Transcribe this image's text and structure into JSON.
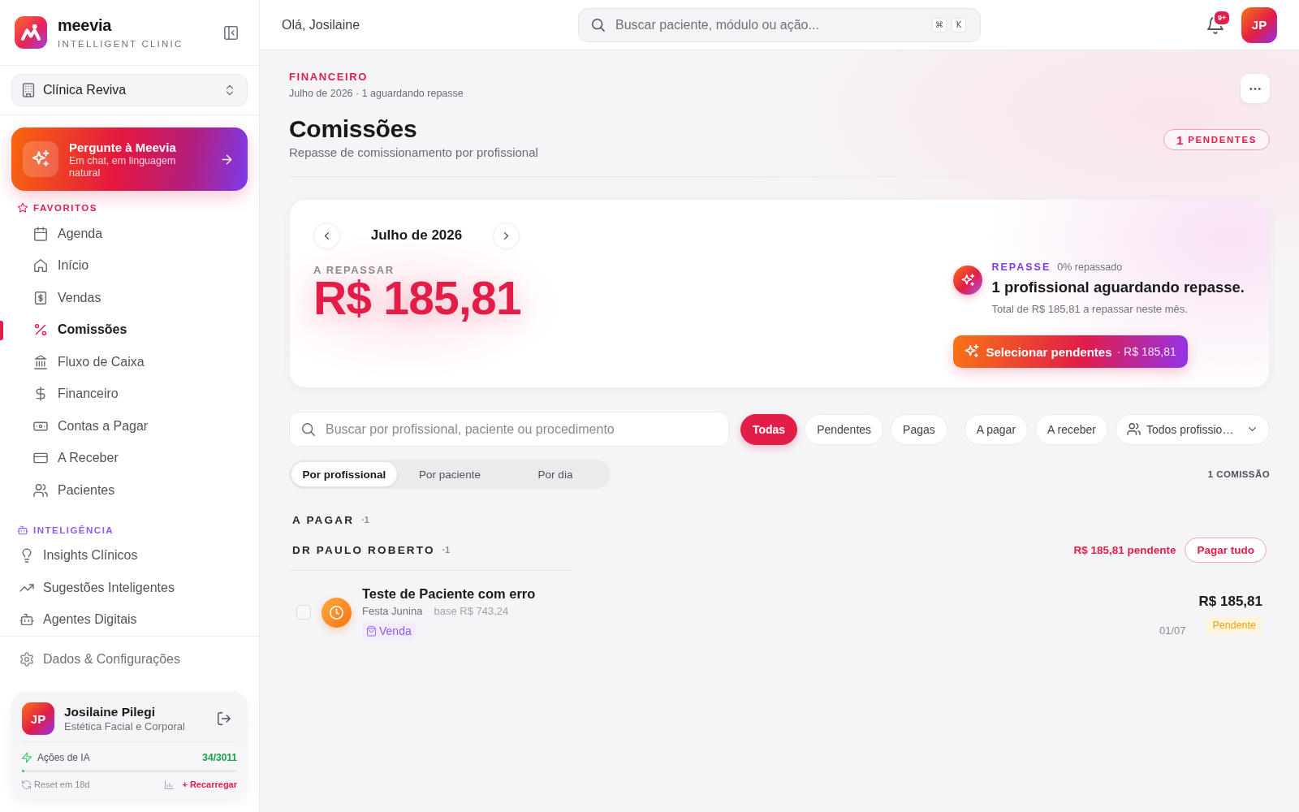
{
  "sidebar": {
    "brand": {
      "name": "meevia",
      "tagline": "INTELLIGENT CLINIC"
    },
    "clinic_selector": {
      "value": "Clínica Reviva"
    },
    "assistant_card": {
      "title": "Pergunte à Meevia",
      "subtitle": "Em chat, em linguagem natural"
    },
    "sections": [
      {
        "kind": "favorites",
        "title": "FAVORITOS",
        "items": [
          {
            "label": "Agenda",
            "selected": false
          },
          {
            "label": "Início",
            "selected": false
          },
          {
            "label": "Vendas",
            "selected": false
          },
          {
            "label": "Comissões",
            "selected": true
          },
          {
            "label": "Fluxo de Caixa",
            "selected": false
          },
          {
            "label": "Financeiro",
            "selected": false
          },
          {
            "label": "Contas a Pagar",
            "selected": false
          },
          {
            "label": "A Receber",
            "selected": false
          },
          {
            "label": "Pacientes",
            "selected": false
          }
        ]
      },
      {
        "kind": "intelligence",
        "title": "INTELIGÊNCIA",
        "items": [
          {
            "label": "Insights Clínicos",
            "selected": false
          },
          {
            "label": "Sugestões Inteligentes",
            "selected": false
          },
          {
            "label": "Agentes Digitais",
            "selected": false
          }
        ]
      }
    ],
    "settings_item": {
      "label": "Dados & Configurações"
    },
    "user_card": {
      "initials": "JP",
      "name": "Josilaine Pilegi",
      "role": "Estética Facial e Corporal",
      "ai_usage": {
        "label": "Ações de IA",
        "count": "34/3011",
        "level": 0.011,
        "reset": "Reset em 18d",
        "recharge": "+ Recarregar"
      }
    }
  },
  "top_bar": {
    "greeting": "Olá, Josilaine",
    "search": {
      "placeholder": "Buscar paciente, módulo ou ação...",
      "shortcut_keys": [
        "⌘",
        "K"
      ]
    },
    "notification_badge": "9+",
    "avatar_initials": "JP"
  },
  "page_header": {
    "eyebrow": "FINANCEIRO",
    "context": "Julho de 2026 · 1 aguardando repasse",
    "title": "Comissões",
    "subtitle": "Repasse de comissionamento por profissional",
    "pending_badge": {
      "count": "1",
      "label": "PENDENTES"
    }
  },
  "summary_card": {
    "period": "Julho de 2026",
    "amount_label": "A REPASSAR",
    "amount": "R$ 185,81",
    "insight": {
      "tag": "REPASSE",
      "progress": "0% repassado",
      "headline": "1 profissional aguardando repasse.",
      "detail": "Total de R$ 185,81 a repassar neste mês.",
      "action": {
        "label": "Selecionar pendentes",
        "amount": "· R$ 185,81"
      }
    }
  },
  "filters": {
    "search": {
      "placeholder": "Buscar por profissional, paciente ou procedimento"
    },
    "status_chips": [
      {
        "label": "Todas",
        "selected": true
      },
      {
        "label": "Pendentes",
        "selected": false
      },
      {
        "label": "Pagas",
        "selected": false
      }
    ],
    "type_chips": [
      {
        "label": "A pagar",
        "selected": false
      },
      {
        "label": "A receber",
        "selected": false
      }
    ],
    "professional_select": {
      "value": "Todos profissio…"
    }
  },
  "view_tabs": {
    "tabs": [
      {
        "label": "Por profissional",
        "selected": true
      },
      {
        "label": "Por paciente",
        "selected": false
      },
      {
        "label": "Por dia",
        "selected": false
      }
    ],
    "count": "1 COMISSÃO"
  },
  "commission_groups": [
    {
      "title": "A PAGAR",
      "count": "·1",
      "professionals": [
        {
          "name": "DR PAULO ROBERTO",
          "count": "·1",
          "pending_total": "R$ 185,81 pendente",
          "action": "Pagar tudo",
          "entries": [
            {
              "checked": false,
              "patient": "Teste de Paciente com erro",
              "procedure": "Festa Junina",
              "base": "base R$ 743,24",
              "tag": "Venda",
              "amount": "R$ 185,81",
              "date": "01/07",
              "status": {
                "kind": "pending",
                "label": "Pendente"
              }
            }
          ]
        }
      ]
    }
  ]
}
